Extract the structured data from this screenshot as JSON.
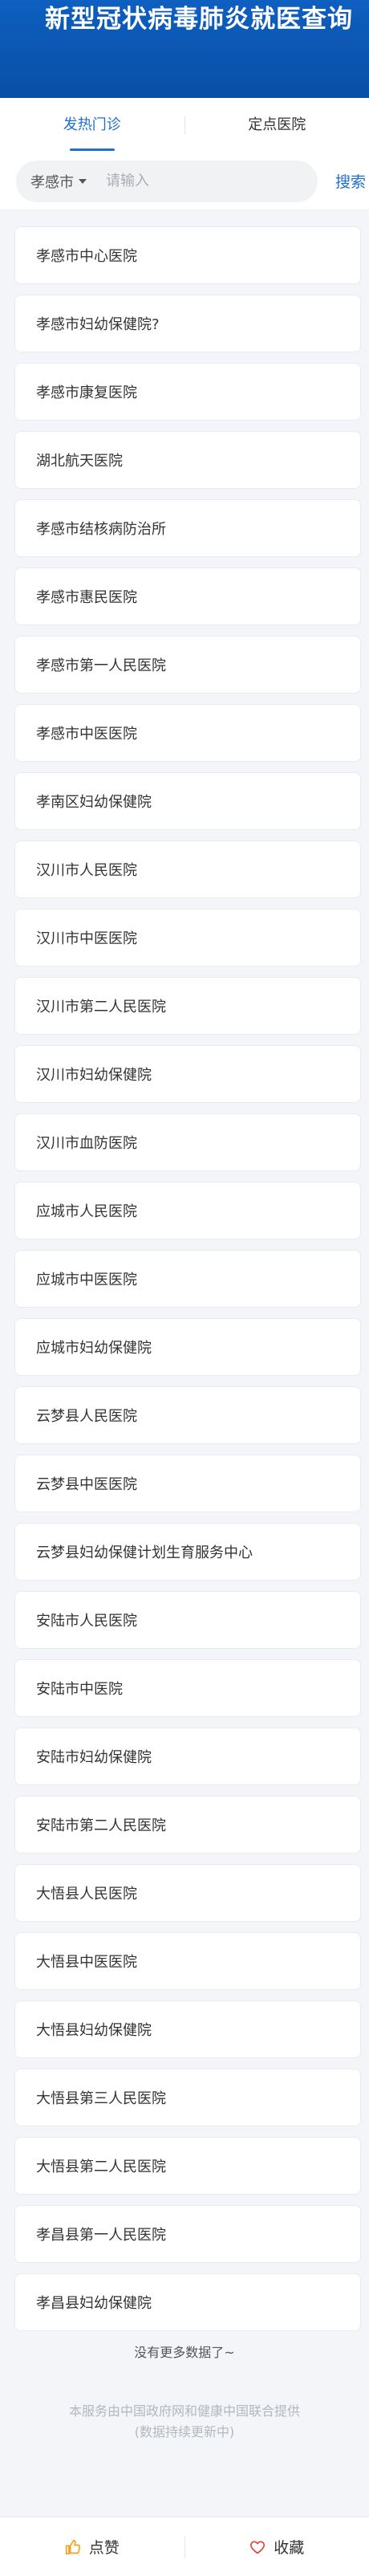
{
  "header": {
    "title": "新型冠状病毒肺炎就医查询"
  },
  "tabs": [
    {
      "label": "发热门诊",
      "active": true
    },
    {
      "label": "定点医院",
      "active": false
    }
  ],
  "search": {
    "city": "孝感市",
    "placeholder": "请输入",
    "value": "",
    "button_label": "搜索"
  },
  "hospitals": [
    "孝感市中心医院",
    "孝感市妇幼保健院?",
    "孝感市康复医院",
    "湖北航天医院",
    "孝感市结核病防治所",
    "孝感市惠民医院",
    "孝感市第一人民医院",
    "孝感市中医医院",
    "孝南区妇幼保健院",
    "汉川市人民医院",
    "汉川市中医医院",
    "汉川市第二人民医院",
    "汉川市妇幼保健院",
    "汉川市血防医院",
    "应城市人民医院",
    "应城市中医医院",
    "应城市妇幼保健院",
    "云梦县人民医院",
    "云梦县中医医院",
    "云梦县妇幼保健计划生育服务中心",
    "安陆市人民医院",
    "安陆市中医院",
    "安陆市妇幼保健院",
    "安陆市第二人民医院",
    "大悟县人民医院",
    "大悟县中医医院",
    "大悟县妇幼保健院",
    "大悟县第三人民医院",
    "大悟县第二人民医院",
    "孝昌县第一人民医院",
    "孝昌县妇幼保健院"
  ],
  "list_end_text": "没有更多数据了~",
  "footer": {
    "line1": "本服务由中国政府网和健康中国联合提供",
    "line2": "(数据持续更新中)"
  },
  "bottom_bar": {
    "like_label": "点赞",
    "like_icon": "thumbs-up-icon",
    "favorite_label": "收藏",
    "favorite_icon": "heart-icon"
  },
  "colors": {
    "header_bg": "#0b59b8",
    "accent": "#1f6fce",
    "like_icon": "#f0a020",
    "favorite_icon": "#e0453c"
  }
}
